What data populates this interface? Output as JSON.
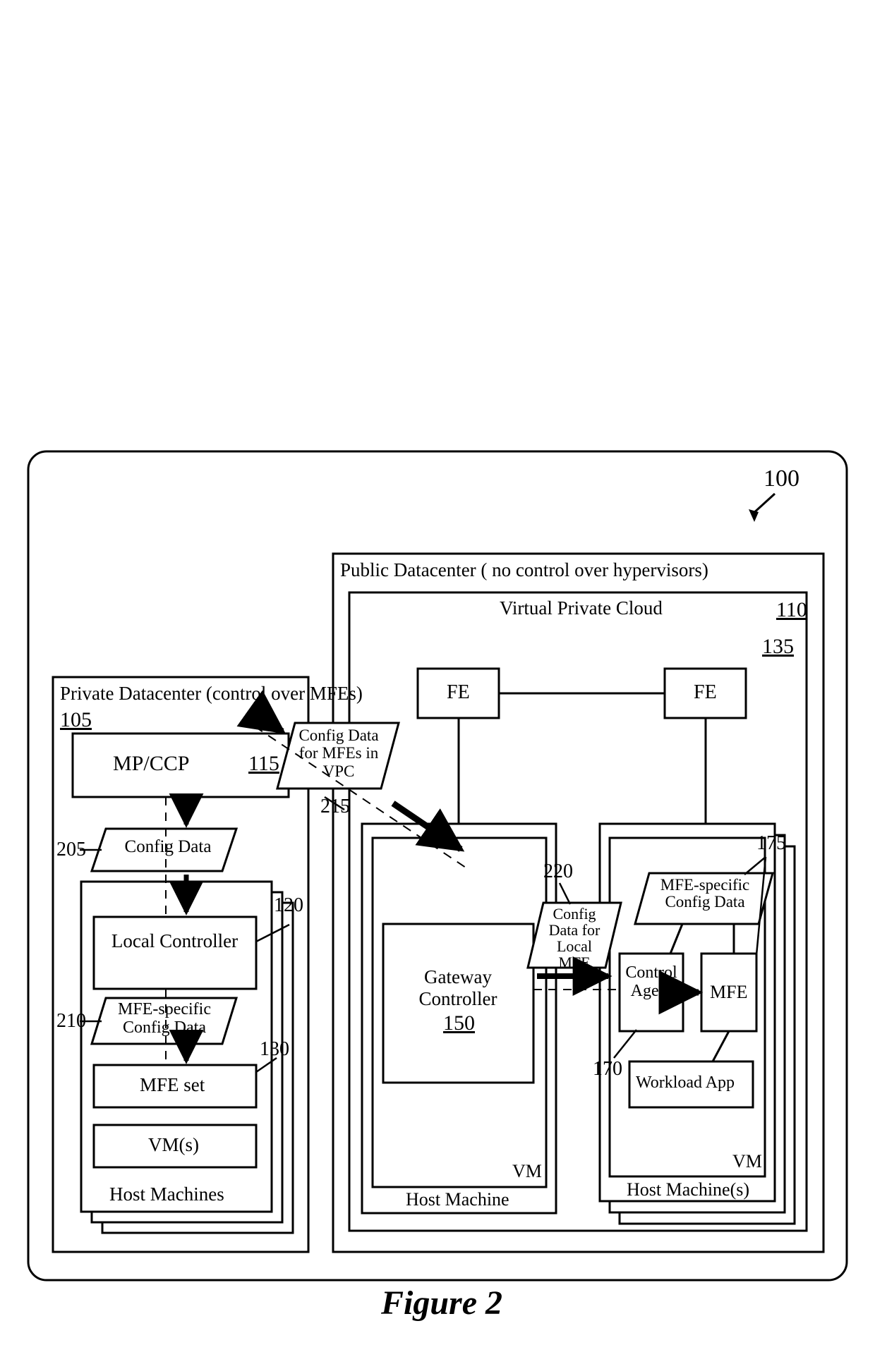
{
  "figure": {
    "caption": "Figure 2",
    "top_ref": "100"
  },
  "private_dc": {
    "title": "Private Datacenter (control over MFEs)",
    "ref": "105",
    "mpccp": {
      "label": "MP/CCP",
      "ref": "115"
    },
    "config_data": {
      "label": "Config Data",
      "ref": "205"
    },
    "local_controller": {
      "label": "Local Controller",
      "ref": "120"
    },
    "mfe_specific_config": {
      "label": "MFE-specific Config Data",
      "ref": "210"
    },
    "mfe_set": {
      "label": "MFE set",
      "ref": "130"
    },
    "vms": {
      "label": "VM(s)"
    },
    "host_machines": {
      "label": "Host Machines"
    }
  },
  "link": {
    "config_for_vpc": {
      "label": "Config Data for MFEs in VPC",
      "ref": "215"
    }
  },
  "public_dc": {
    "title": "Public Datacenter ( no control over hypervisors)",
    "ref": "110",
    "vpc": {
      "title": "Virtual Private Cloud",
      "ref": "135"
    },
    "fe1": "FE",
    "fe2": "FE",
    "gateway": {
      "label": "Gateway Controller",
      "ref": "150",
      "vm": "VM",
      "host": "Host Machine"
    },
    "config_local_mfe": {
      "label": "Config Data for Local MFE",
      "ref": "220"
    },
    "workload": {
      "control_agent": {
        "label": "Control Agent",
        "ref": "170"
      },
      "mfe_specific": {
        "label": "MFE-specific Config Data",
        "ref": "175"
      },
      "mfe": "MFE",
      "workload_app": "Workload App",
      "vm": "VM",
      "host": "Host Machine(s)"
    }
  }
}
